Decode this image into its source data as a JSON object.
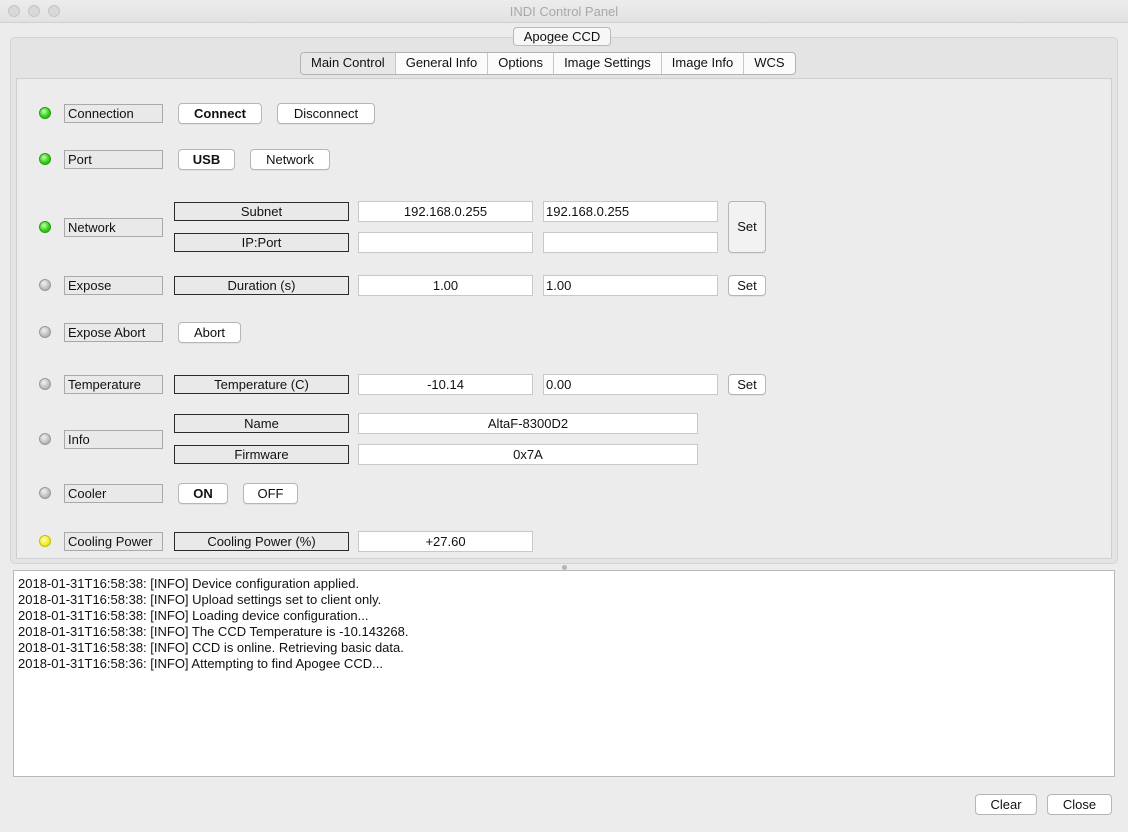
{
  "window": {
    "title": "INDI Control Panel"
  },
  "device": {
    "name": "Apogee CCD"
  },
  "tabs": [
    "Main Control",
    "General Info",
    "Options",
    "Image Settings",
    "Image Info",
    "WCS"
  ],
  "properties": {
    "connection": {
      "label": "Connection",
      "state": "ok",
      "buttons": [
        "Connect",
        "Disconnect"
      ],
      "active": "Connect"
    },
    "port": {
      "label": "Port",
      "state": "ok",
      "buttons": [
        "USB",
        "Network"
      ],
      "active": "USB"
    },
    "network": {
      "label": "Network",
      "state": "ok",
      "set_label": "Set",
      "elements": [
        {
          "label": "Subnet",
          "value": "192.168.0.255",
          "input": "192.168.0.255"
        },
        {
          "label": "IP:Port",
          "value": "",
          "input": ""
        }
      ]
    },
    "expose": {
      "label": "Expose",
      "state": "idle",
      "set_label": "Set",
      "elements": [
        {
          "label": "Duration (s)",
          "value": "1.00",
          "input": "1.00"
        }
      ]
    },
    "expose_abort": {
      "label": "Expose Abort",
      "state": "idle",
      "buttons": [
        "Abort"
      ]
    },
    "temperature": {
      "label": "Temperature",
      "state": "idle",
      "set_label": "Set",
      "elements": [
        {
          "label": "Temperature (C)",
          "value": "-10.14",
          "input": "0.00"
        }
      ]
    },
    "info": {
      "label": "Info",
      "state": "idle",
      "elements": [
        {
          "label": "Name",
          "value": "AltaF-8300D2"
        },
        {
          "label": "Firmware",
          "value": "0x7A"
        }
      ]
    },
    "cooler": {
      "label": "Cooler",
      "state": "idle",
      "buttons": [
        "ON",
        "OFF"
      ],
      "active": "ON"
    },
    "cooling_power": {
      "label": "Cooling Power",
      "state": "busy",
      "elements": [
        {
          "label": "Cooling Power (%)",
          "value": "+27.60"
        }
      ]
    }
  },
  "status_colors": {
    "ok": "#35d11a",
    "idle": "#bdbdbd",
    "busy": "#f4ee2a"
  },
  "log": [
    "2018-01-31T16:58:38: [INFO] Device configuration applied.",
    "2018-01-31T16:58:38: [INFO] Upload settings set to client only.",
    "2018-01-31T16:58:38: [INFO] Loading device configuration...",
    "2018-01-31T16:58:38: [INFO] The CCD Temperature is -10.143268.",
    "2018-01-31T16:58:38: [INFO] CCD is online. Retrieving basic data.",
    "2018-01-31T16:58:36: [INFO] Attempting to find Apogee CCD..."
  ],
  "footer": {
    "clear_label": "Clear",
    "close_label": "Close"
  }
}
